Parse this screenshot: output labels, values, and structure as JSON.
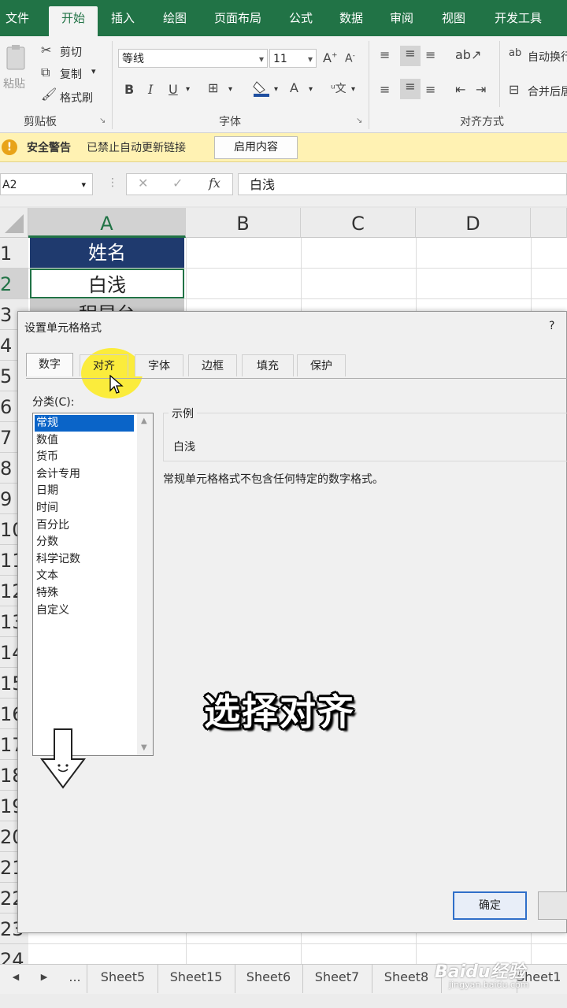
{
  "ribbon": {
    "tabs": [
      "文件",
      "开始",
      "插入",
      "绘图",
      "页面布局",
      "公式",
      "数据",
      "审阅",
      "视图",
      "开发工具"
    ],
    "clipboard": {
      "paste": "粘贴",
      "cut": "剪切",
      "copy": "复制",
      "format_painter": "格式刷",
      "group_label": "剪贴板"
    },
    "font": {
      "name": "等线",
      "size": "11",
      "group_label": "字体"
    },
    "alignment": {
      "wrap": "自动换行",
      "merge": "合并后居中",
      "group_label": "对齐方式"
    }
  },
  "security": {
    "title": "安全警告",
    "message": "已禁止自动更新链接",
    "button": "启用内容"
  },
  "formula_bar": {
    "name_box": "A2",
    "value": "白浅"
  },
  "grid": {
    "columns": [
      "A",
      "B",
      "C",
      "D"
    ],
    "rows": [
      "1",
      "2",
      "3",
      "4",
      "5",
      "6",
      "7",
      "8",
      "9",
      "10",
      "11",
      "12",
      "13",
      "14",
      "15",
      "16",
      "17",
      "18",
      "19",
      "20",
      "21",
      "22",
      "23",
      "24"
    ],
    "cells": {
      "A1": "姓名",
      "A2": "白浅",
      "A3": "程昱台"
    }
  },
  "dialog": {
    "title": "设置单元格格式",
    "help": "?",
    "tabs": [
      "数字",
      "对齐",
      "字体",
      "边框",
      "填充",
      "保护"
    ],
    "category_label": "分类(C):",
    "categories": [
      "常规",
      "数值",
      "货币",
      "会计专用",
      "日期",
      "时间",
      "百分比",
      "分数",
      "科学记数",
      "文本",
      "特殊",
      "自定义"
    ],
    "sample_label": "示例",
    "sample_value": "白浅",
    "description": "常规单元格格式不包含任何特定的数字格式。",
    "ok": "确定"
  },
  "overlay_caption": "选择对齐",
  "sheets": {
    "tabs": [
      "Sheet5",
      "Sheet15",
      "Sheet6",
      "Sheet7",
      "Sheet8",
      "Sheet1"
    ],
    "more": "..."
  },
  "watermark": {
    "brand": "Baidu经验",
    "url": "jingyan.baidu.com"
  },
  "colors": {
    "excel_green": "#217346",
    "header_blue": "#1f3a6e",
    "selection_blue": "#0a64c8",
    "warning_bg": "#fff2b3"
  }
}
